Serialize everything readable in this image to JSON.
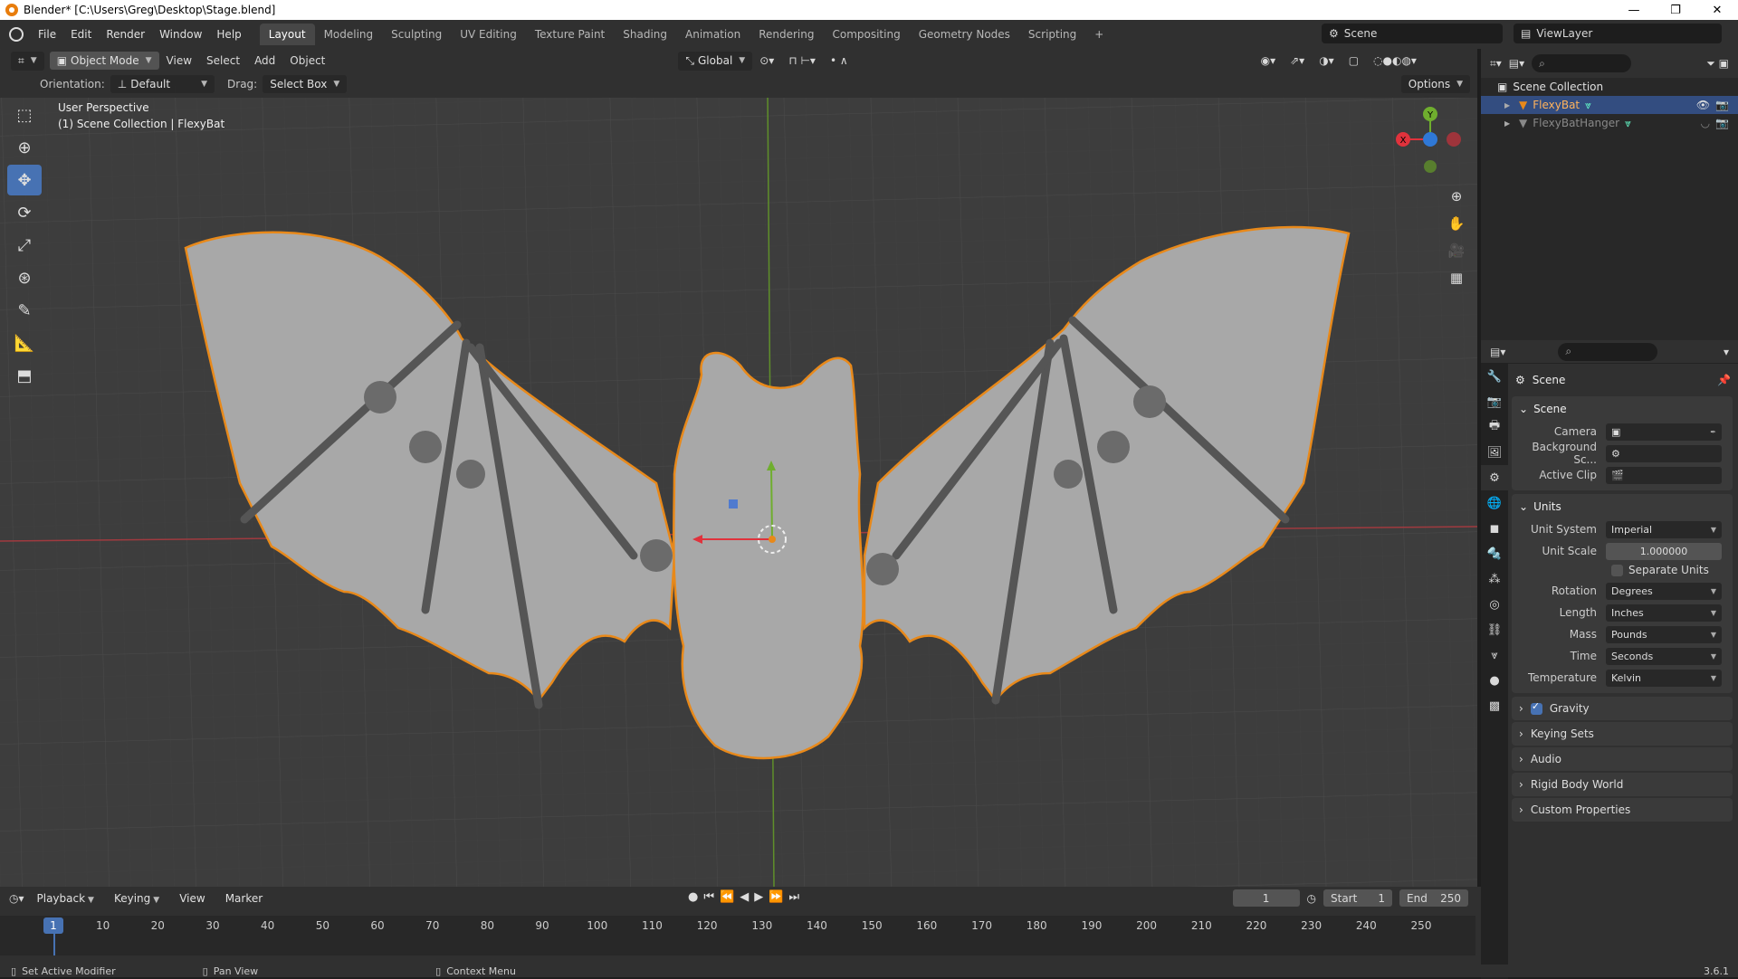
{
  "window": {
    "title": "Blender* [C:\\Users\\Greg\\Desktop\\Stage.blend]",
    "min": "—",
    "max": "❐",
    "close": "✕"
  },
  "menu": {
    "items": [
      "File",
      "Edit",
      "Render",
      "Window",
      "Help"
    ]
  },
  "workspaces": [
    "Layout",
    "Modeling",
    "Sculpting",
    "UV Editing",
    "Texture Paint",
    "Shading",
    "Animation",
    "Rendering",
    "Compositing",
    "Geometry Nodes",
    "Scripting",
    "+"
  ],
  "active_workspace": "Layout",
  "scene_selector": "Scene",
  "viewlayer_selector": "ViewLayer",
  "viewport": {
    "mode": "Object Mode",
    "menus": [
      "View",
      "Select",
      "Add",
      "Object"
    ],
    "transform_orientation": "Global",
    "orientation_label": "Orientation:",
    "orientation_value": "Default",
    "drag_label": "Drag:",
    "drag_value": "Select Box",
    "options": "Options",
    "perspective": "User Perspective",
    "collection_info": "(1) Scene Collection | FlexyBat",
    "gizmo": {
      "x": "X",
      "y": "Y",
      "z": "Z"
    }
  },
  "outliner": {
    "root": "Scene Collection",
    "items": [
      {
        "name": "FlexyBat",
        "selected": true
      },
      {
        "name": "FlexyBatHanger",
        "selected": false
      }
    ]
  },
  "properties": {
    "context_title": "Scene",
    "scene_panel": {
      "title": "Scene",
      "camera_label": "Camera",
      "background_label": "Background Sc...",
      "active_clip_label": "Active Clip"
    },
    "units_panel": {
      "title": "Units",
      "unit_system_label": "Unit System",
      "unit_system": "Imperial",
      "unit_scale_label": "Unit Scale",
      "unit_scale": "1.000000",
      "separate_units": "Separate Units",
      "rotation_label": "Rotation",
      "rotation": "Degrees",
      "length_label": "Length",
      "length": "Inches",
      "mass_label": "Mass",
      "mass": "Pounds",
      "time_label": "Time",
      "time": "Seconds",
      "temperature_label": "Temperature",
      "temperature": "Kelvin"
    },
    "collapsed": [
      "Gravity",
      "Keying Sets",
      "Audio",
      "Rigid Body World",
      "Custom Properties"
    ]
  },
  "timeline": {
    "menus": [
      "Playback",
      "Keying",
      "View",
      "Marker"
    ],
    "current_frame": "1",
    "start_label": "Start",
    "start": "1",
    "end_label": "End",
    "end": "250",
    "ruler": [
      "1",
      "10",
      "20",
      "30",
      "40",
      "50",
      "60",
      "70",
      "80",
      "90",
      "100",
      "110",
      "120",
      "130",
      "140",
      "150",
      "160",
      "170",
      "180",
      "190",
      "200",
      "210",
      "220",
      "230",
      "240",
      "250"
    ]
  },
  "status": {
    "left": "Set Active Modifier",
    "middle": "Pan View",
    "right": "Context Menu",
    "version": "3.6.1"
  },
  "colors": {
    "accent": "#4772b3",
    "selection": "#e8891a",
    "x_axis": "#c8303a",
    "y_axis": "#6a9a27",
    "z_axis": "#2f78d6"
  }
}
